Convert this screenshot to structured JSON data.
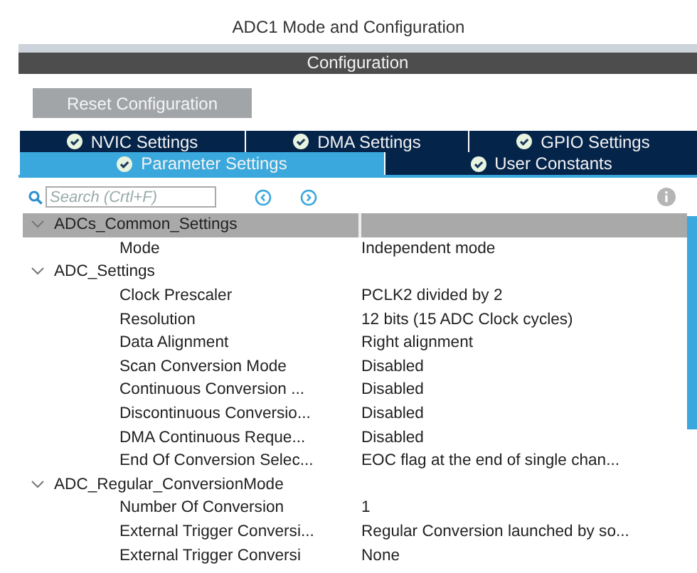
{
  "window": {
    "title": "ADC1 Mode and Configuration"
  },
  "section_header": "Configuration",
  "reset_button": "Reset Configuration",
  "tab_rows": [
    [
      {
        "label": "NVIC Settings",
        "selected": false
      },
      {
        "label": "DMA Settings",
        "selected": false
      },
      {
        "label": "GPIO Settings",
        "selected": false
      }
    ],
    [
      {
        "label": "Parameter Settings",
        "selected": true
      },
      {
        "label": "User Constants",
        "selected": false
      }
    ]
  ],
  "search": {
    "placeholder": "Search (Crtl+F)"
  },
  "tree": [
    {
      "label": "ADCs_Common_Settings",
      "expanded": true,
      "selected": true,
      "children": [
        {
          "name": "Mode",
          "value": "Independent mode"
        }
      ]
    },
    {
      "label": "ADC_Settings",
      "expanded": true,
      "selected": false,
      "children": [
        {
          "name": "Clock Prescaler",
          "value": "PCLK2 divided by 2"
        },
        {
          "name": "Resolution",
          "value": "12 bits (15 ADC Clock cycles)"
        },
        {
          "name": "Data Alignment",
          "value": "Right alignment"
        },
        {
          "name": "Scan Conversion Mode",
          "value": "Disabled"
        },
        {
          "name": "Continuous Conversion ...",
          "value": "Disabled"
        },
        {
          "name": "Discontinuous Conversio...",
          "value": "Disabled"
        },
        {
          "name": "DMA Continuous Reque...",
          "value": "Disabled"
        },
        {
          "name": "End Of Conversion Selec...",
          "value": "EOC flag at the end of single chan..."
        }
      ]
    },
    {
      "label": "ADC_Regular_ConversionMode",
      "expanded": true,
      "selected": false,
      "children": [
        {
          "name": "Number Of Conversion",
          "value": "1"
        },
        {
          "name": "External Trigger Conversi...",
          "value": "Regular Conversion launched by so..."
        },
        {
          "name": "External Trigger Conversi",
          "value": "None"
        }
      ]
    }
  ]
}
